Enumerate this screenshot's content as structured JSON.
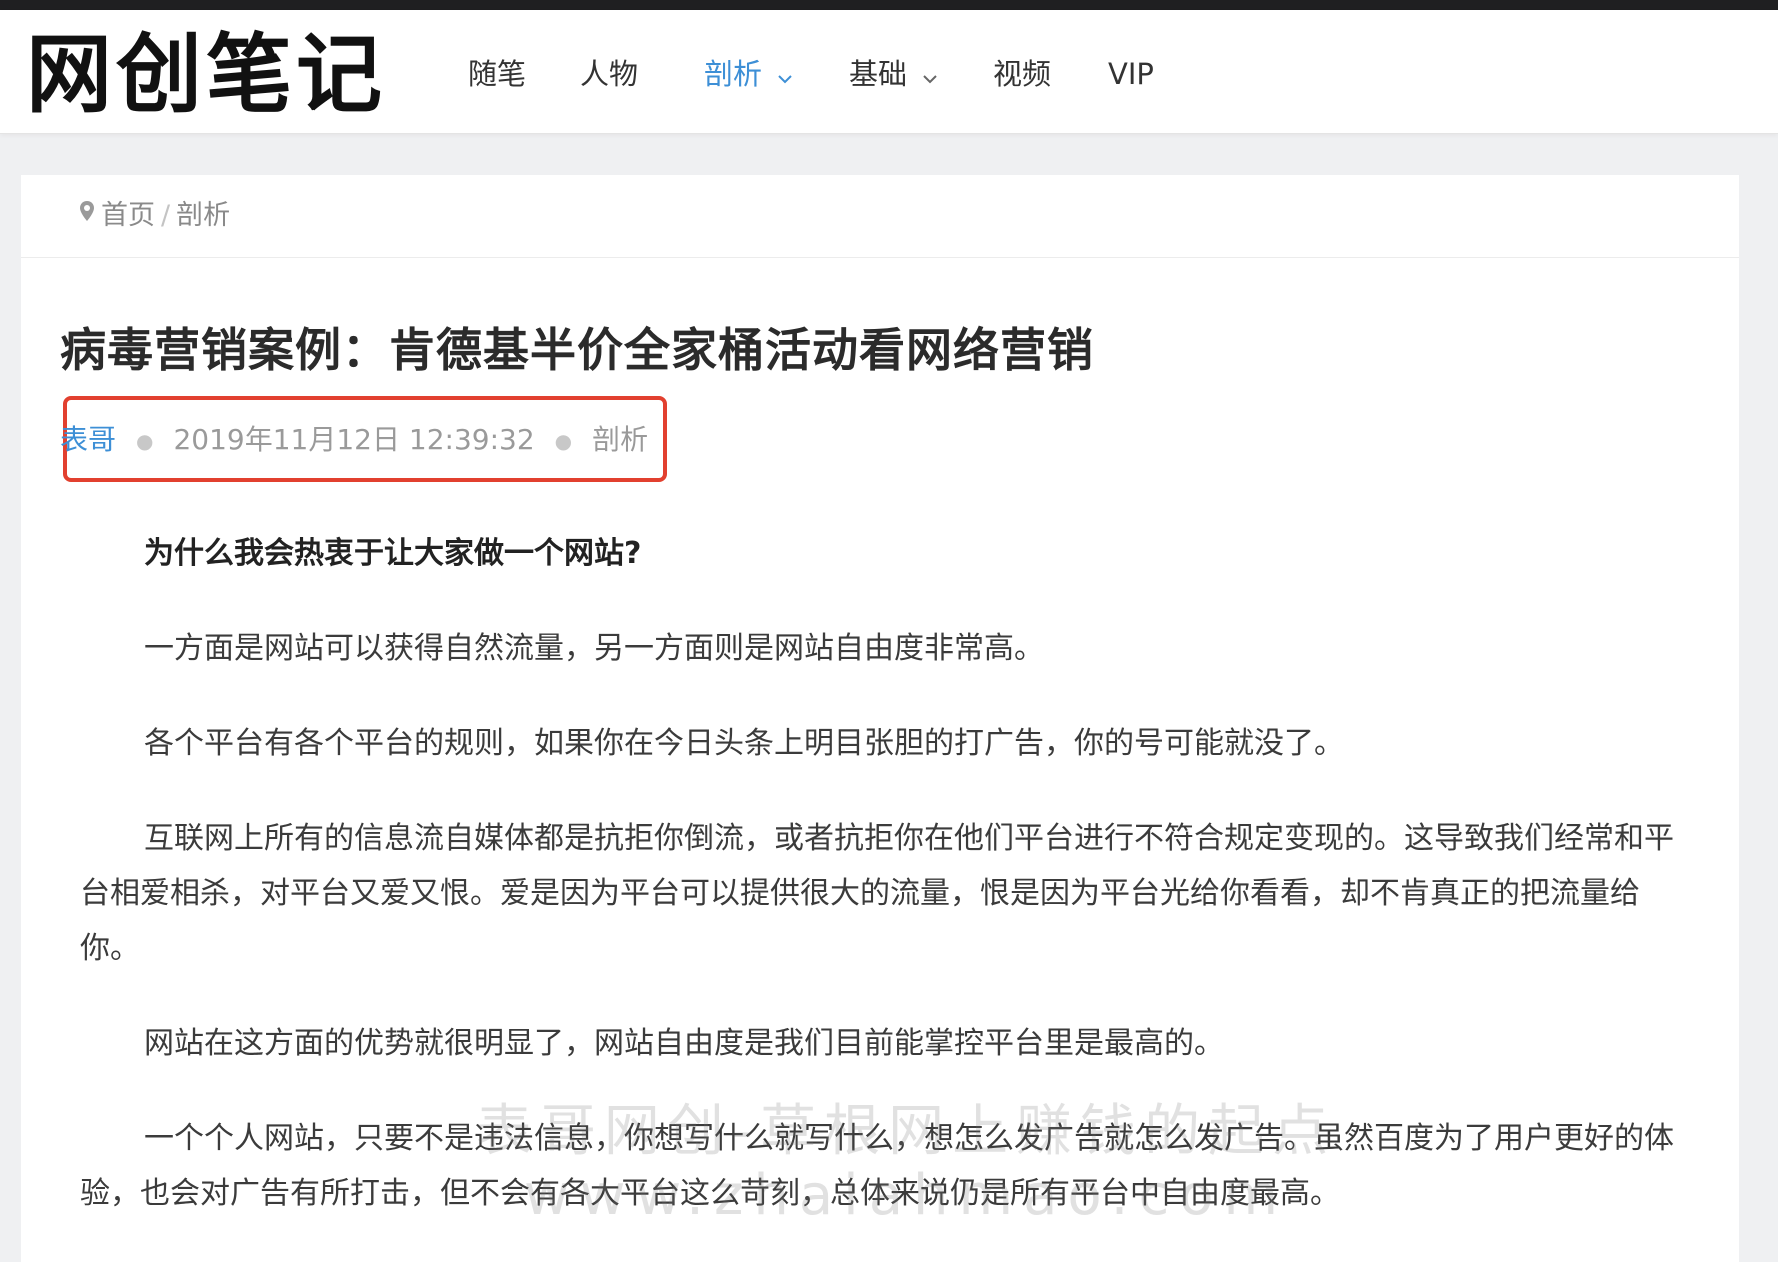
{
  "header": {
    "logo_text": "网创笔记",
    "nav": [
      {
        "label": "随笔",
        "has_dropdown": false,
        "active": false
      },
      {
        "label": "人物",
        "has_dropdown": false,
        "active": false
      },
      {
        "label": "剖析",
        "has_dropdown": true,
        "active": true
      },
      {
        "label": "基础",
        "has_dropdown": true,
        "active": false
      },
      {
        "label": "视频",
        "has_dropdown": false,
        "active": false
      },
      {
        "label": "VIP",
        "has_dropdown": false,
        "active": false
      }
    ]
  },
  "breadcrumb": {
    "home": "首页",
    "separator": "/",
    "current": "剖析"
  },
  "article": {
    "title": "病毒营销案例：肯德基半价全家桶活动看网络营销",
    "author": "表哥",
    "date": "2019年11月12日 12:39:32",
    "category": "剖析",
    "paragraphs": [
      {
        "text": "为什么我会热衷于让大家做一个网站?",
        "bold": true
      },
      {
        "text": "一方面是网站可以获得自然流量，另一方面则是网站自由度非常高。",
        "bold": false
      },
      {
        "text": "各个平台有各个平台的规则，如果你在今日头条上明目张胆的打广告，你的号可能就没了。",
        "bold": false
      },
      {
        "text": "互联网上所有的信息流自媒体都是抗拒你倒流，或者抗拒你在他们平台进行不符合规定变现的。这导致我们经常和平台相爱相杀，对平台又爱又恨。爱是因为平台可以提供很大的流量，恨是因为平台光给你看看，却不肯真正的把流量给你。",
        "bold": false
      },
      {
        "text": "网站在这方面的优势就很明显了，网站自由度是我们目前能掌控平台里是最高的。",
        "bold": false
      },
      {
        "text": "一个个人网站，只要不是违法信息，你想写什么就写什么，想怎么发广告就怎么发广告。虽然百度为了用户更好的体验，也会对广告有所打击，但不会有各大平台这么苛刻，总体来说仍是所有平台中自由度最高。",
        "bold": false
      }
    ]
  },
  "watermark": {
    "line1": "表哥网创-草根网上赚钱的起点",
    "line2": "www.zhaiahmao.com"
  },
  "colors": {
    "accent": "#3d8fd6",
    "highlight_box": "#e2402f",
    "topbar": "#1f1f21"
  }
}
